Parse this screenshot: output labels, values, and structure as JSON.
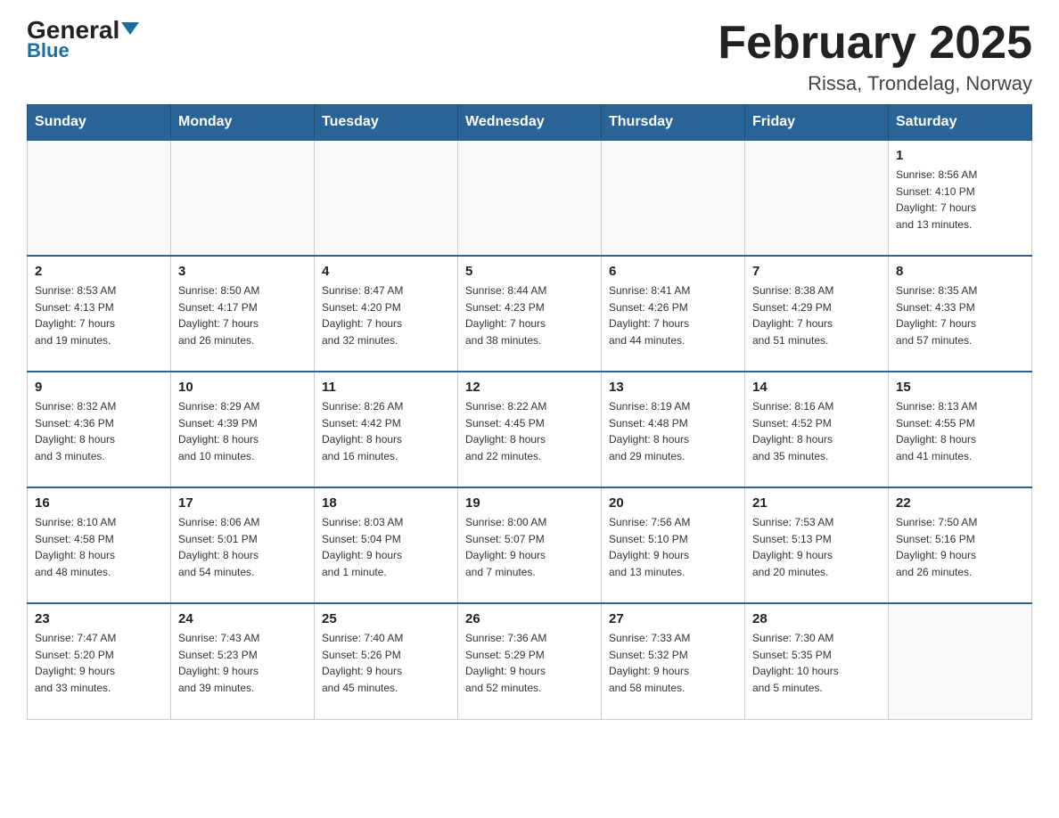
{
  "logo": {
    "general": "General",
    "blue": "Blue"
  },
  "header": {
    "title": "February 2025",
    "subtitle": "Rissa, Trondelag, Norway"
  },
  "weekdays": [
    "Sunday",
    "Monday",
    "Tuesday",
    "Wednesday",
    "Thursday",
    "Friday",
    "Saturday"
  ],
  "weeks": [
    [
      {
        "day": "",
        "info": ""
      },
      {
        "day": "",
        "info": ""
      },
      {
        "day": "",
        "info": ""
      },
      {
        "day": "",
        "info": ""
      },
      {
        "day": "",
        "info": ""
      },
      {
        "day": "",
        "info": ""
      },
      {
        "day": "1",
        "info": "Sunrise: 8:56 AM\nSunset: 4:10 PM\nDaylight: 7 hours\nand 13 minutes."
      }
    ],
    [
      {
        "day": "2",
        "info": "Sunrise: 8:53 AM\nSunset: 4:13 PM\nDaylight: 7 hours\nand 19 minutes."
      },
      {
        "day": "3",
        "info": "Sunrise: 8:50 AM\nSunset: 4:17 PM\nDaylight: 7 hours\nand 26 minutes."
      },
      {
        "day": "4",
        "info": "Sunrise: 8:47 AM\nSunset: 4:20 PM\nDaylight: 7 hours\nand 32 minutes."
      },
      {
        "day": "5",
        "info": "Sunrise: 8:44 AM\nSunset: 4:23 PM\nDaylight: 7 hours\nand 38 minutes."
      },
      {
        "day": "6",
        "info": "Sunrise: 8:41 AM\nSunset: 4:26 PM\nDaylight: 7 hours\nand 44 minutes."
      },
      {
        "day": "7",
        "info": "Sunrise: 8:38 AM\nSunset: 4:29 PM\nDaylight: 7 hours\nand 51 minutes."
      },
      {
        "day": "8",
        "info": "Sunrise: 8:35 AM\nSunset: 4:33 PM\nDaylight: 7 hours\nand 57 minutes."
      }
    ],
    [
      {
        "day": "9",
        "info": "Sunrise: 8:32 AM\nSunset: 4:36 PM\nDaylight: 8 hours\nand 3 minutes."
      },
      {
        "day": "10",
        "info": "Sunrise: 8:29 AM\nSunset: 4:39 PM\nDaylight: 8 hours\nand 10 minutes."
      },
      {
        "day": "11",
        "info": "Sunrise: 8:26 AM\nSunset: 4:42 PM\nDaylight: 8 hours\nand 16 minutes."
      },
      {
        "day": "12",
        "info": "Sunrise: 8:22 AM\nSunset: 4:45 PM\nDaylight: 8 hours\nand 22 minutes."
      },
      {
        "day": "13",
        "info": "Sunrise: 8:19 AM\nSunset: 4:48 PM\nDaylight: 8 hours\nand 29 minutes."
      },
      {
        "day": "14",
        "info": "Sunrise: 8:16 AM\nSunset: 4:52 PM\nDaylight: 8 hours\nand 35 minutes."
      },
      {
        "day": "15",
        "info": "Sunrise: 8:13 AM\nSunset: 4:55 PM\nDaylight: 8 hours\nand 41 minutes."
      }
    ],
    [
      {
        "day": "16",
        "info": "Sunrise: 8:10 AM\nSunset: 4:58 PM\nDaylight: 8 hours\nand 48 minutes."
      },
      {
        "day": "17",
        "info": "Sunrise: 8:06 AM\nSunset: 5:01 PM\nDaylight: 8 hours\nand 54 minutes."
      },
      {
        "day": "18",
        "info": "Sunrise: 8:03 AM\nSunset: 5:04 PM\nDaylight: 9 hours\nand 1 minute."
      },
      {
        "day": "19",
        "info": "Sunrise: 8:00 AM\nSunset: 5:07 PM\nDaylight: 9 hours\nand 7 minutes."
      },
      {
        "day": "20",
        "info": "Sunrise: 7:56 AM\nSunset: 5:10 PM\nDaylight: 9 hours\nand 13 minutes."
      },
      {
        "day": "21",
        "info": "Sunrise: 7:53 AM\nSunset: 5:13 PM\nDaylight: 9 hours\nand 20 minutes."
      },
      {
        "day": "22",
        "info": "Sunrise: 7:50 AM\nSunset: 5:16 PM\nDaylight: 9 hours\nand 26 minutes."
      }
    ],
    [
      {
        "day": "23",
        "info": "Sunrise: 7:47 AM\nSunset: 5:20 PM\nDaylight: 9 hours\nand 33 minutes."
      },
      {
        "day": "24",
        "info": "Sunrise: 7:43 AM\nSunset: 5:23 PM\nDaylight: 9 hours\nand 39 minutes."
      },
      {
        "day": "25",
        "info": "Sunrise: 7:40 AM\nSunset: 5:26 PM\nDaylight: 9 hours\nand 45 minutes."
      },
      {
        "day": "26",
        "info": "Sunrise: 7:36 AM\nSunset: 5:29 PM\nDaylight: 9 hours\nand 52 minutes."
      },
      {
        "day": "27",
        "info": "Sunrise: 7:33 AM\nSunset: 5:32 PM\nDaylight: 9 hours\nand 58 minutes."
      },
      {
        "day": "28",
        "info": "Sunrise: 7:30 AM\nSunset: 5:35 PM\nDaylight: 10 hours\nand 5 minutes."
      },
      {
        "day": "",
        "info": ""
      }
    ]
  ]
}
